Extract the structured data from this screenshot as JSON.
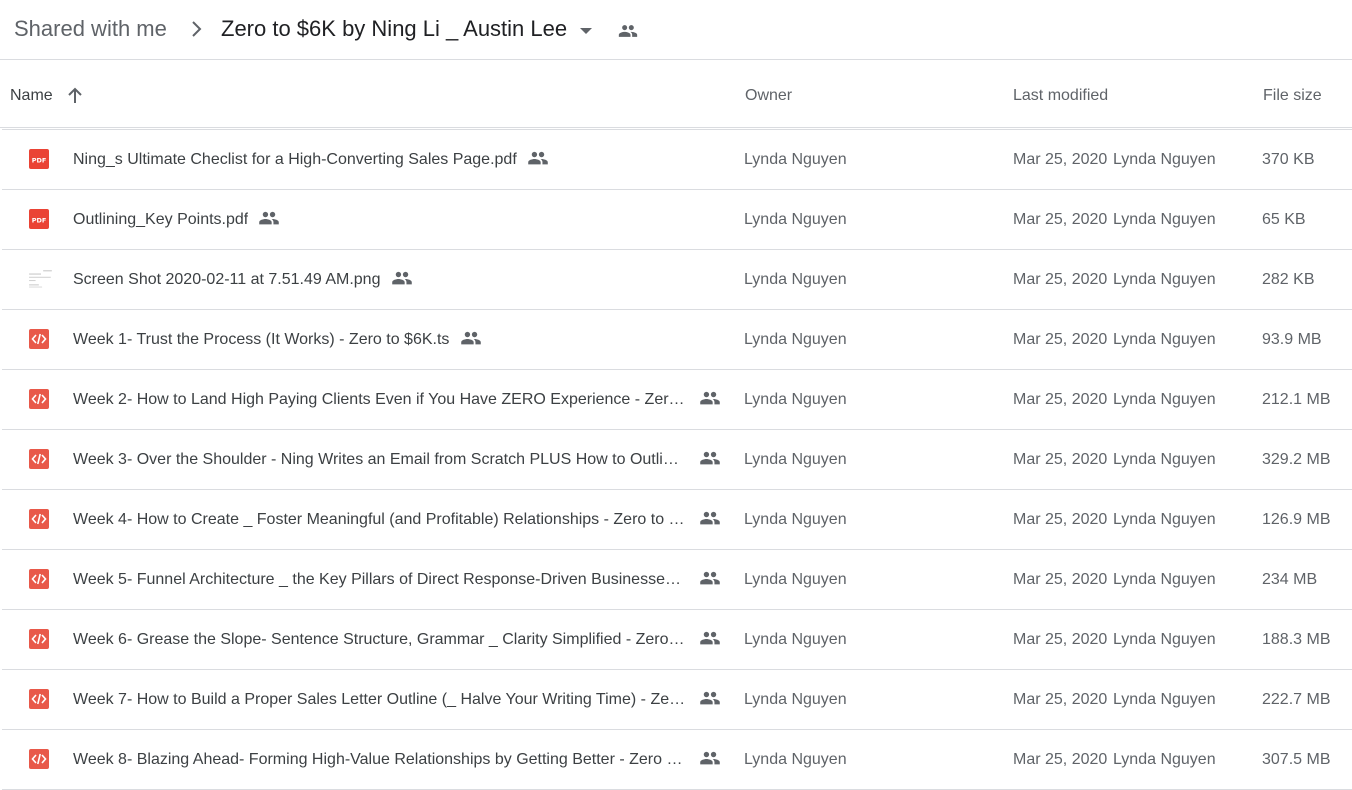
{
  "breadcrumb": {
    "root": "Shared with me",
    "current": "Zero to $6K by Ning Li _ Austin Lee"
  },
  "columns": {
    "name": "Name",
    "owner": "Owner",
    "last_modified": "Last modified",
    "file_size": "File size"
  },
  "colors": {
    "pdf_red": "#ea4335",
    "code_red": "#e8594a",
    "icon_gray": "#5f6368",
    "divider": "#dadce0"
  },
  "files": [
    {
      "name": "Ning_s Ultimate Checlist for a High-Converting Sales Page.pdf",
      "type": "pdf",
      "owner": "Lynda Nguyen",
      "modified": "Mar 25, 2020",
      "modified_by": "Lynda Nguyen",
      "size": "370 KB"
    },
    {
      "name": "Outlining_Key Points.pdf",
      "type": "pdf",
      "owner": "Lynda Nguyen",
      "modified": "Mar 25, 2020",
      "modified_by": "Lynda Nguyen",
      "size": "65 KB"
    },
    {
      "name": "Screen Shot 2020-02-11 at 7.51.49 AM.png",
      "type": "image",
      "owner": "Lynda Nguyen",
      "modified": "Mar 25, 2020",
      "modified_by": "Lynda Nguyen",
      "size": "282 KB"
    },
    {
      "name": "Week 1- Trust the Process (It Works) - Zero to $6K.ts",
      "type": "code",
      "owner": "Lynda Nguyen",
      "modified": "Mar 25, 2020",
      "modified_by": "Lynda Nguyen",
      "size": "93.9 MB"
    },
    {
      "name": "Week 2- How to Land High Paying Clients Even if You Have ZERO Experience - Zero…",
      "type": "code",
      "owner": "Lynda Nguyen",
      "modified": "Mar 25, 2020",
      "modified_by": "Lynda Nguyen",
      "size": "212.1 MB"
    },
    {
      "name": "Week 3- Over the Shoulder - Ning Writes an Email from Scratch PLUS How to Outlin…",
      "type": "code",
      "owner": "Lynda Nguyen",
      "modified": "Mar 25, 2020",
      "modified_by": "Lynda Nguyen",
      "size": "329.2 MB"
    },
    {
      "name": "Week 4- How to Create _ Foster Meaningful (and Profitable) Relationships - Zero to …",
      "type": "code",
      "owner": "Lynda Nguyen",
      "modified": "Mar 25, 2020",
      "modified_by": "Lynda Nguyen",
      "size": "126.9 MB"
    },
    {
      "name": "Week 5- Funnel Architecture _ the Key Pillars of Direct Response-Driven Businesse…",
      "type": "code",
      "owner": "Lynda Nguyen",
      "modified": "Mar 25, 2020",
      "modified_by": "Lynda Nguyen",
      "size": "234 MB"
    },
    {
      "name": "Week 6- Grease the Slope- Sentence Structure, Grammar _ Clarity Simplified - Zero …",
      "type": "code",
      "owner": "Lynda Nguyen",
      "modified": "Mar 25, 2020",
      "modified_by": "Lynda Nguyen",
      "size": "188.3 MB"
    },
    {
      "name": "Week 7- How to Build a Proper Sales Letter Outline (_ Halve Your Writing Time) - Ze…",
      "type": "code",
      "owner": "Lynda Nguyen",
      "modified": "Mar 25, 2020",
      "modified_by": "Lynda Nguyen",
      "size": "222.7 MB"
    },
    {
      "name": "Week 8- Blazing Ahead- Forming High-Value Relationships by Getting Better - Zero …",
      "type": "code",
      "owner": "Lynda Nguyen",
      "modified": "Mar 25, 2020",
      "modified_by": "Lynda Nguyen",
      "size": "307.5 MB"
    }
  ]
}
